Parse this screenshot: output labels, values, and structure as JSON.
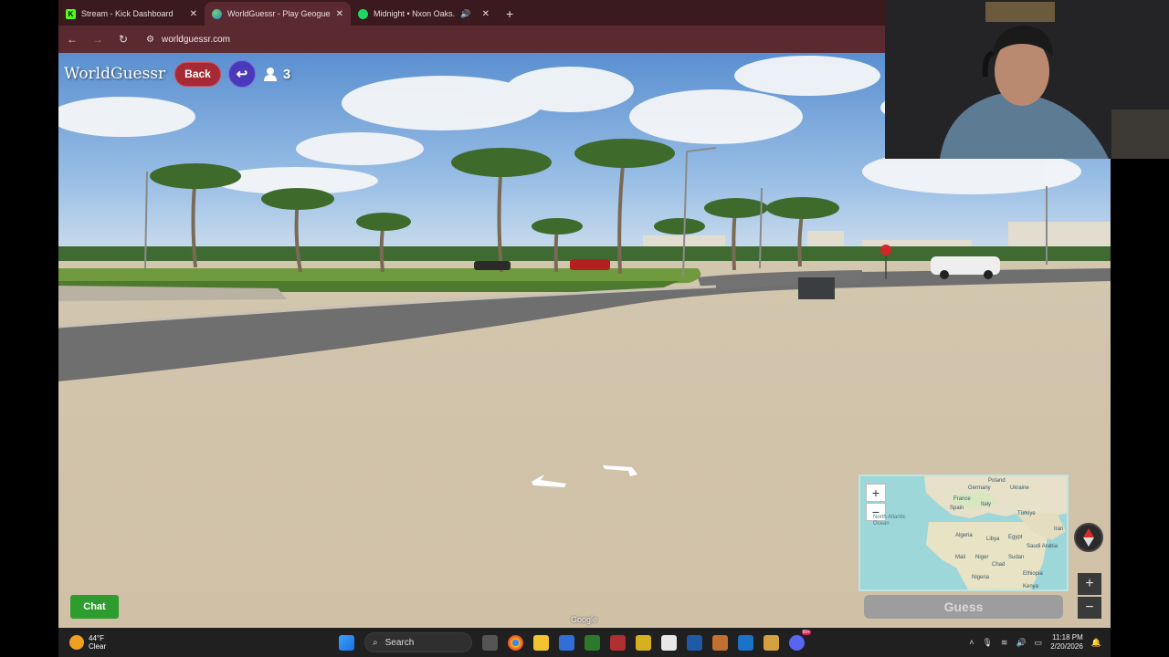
{
  "browser": {
    "tabs": [
      {
        "title": "Stream - Kick Dashboard",
        "favicon": "K",
        "color": "#53fc18",
        "active": false
      },
      {
        "title": "WorldGuessr - Play Geoguessr",
        "favicon": "globe",
        "color": "#3b8bd9",
        "active": true
      },
      {
        "title": "Midnight • Nxon Oaks.",
        "favicon": "spotify",
        "color": "#1ed760",
        "active": false
      }
    ],
    "address": "worldguessr.com"
  },
  "game": {
    "brand": "WorldGuessr",
    "back_label": "Back",
    "players_count": "3",
    "chat_label": "Chat",
    "guess_label": "Guess",
    "google_mark": "Google",
    "map_labels": [
      "Poland",
      "Germany",
      "Ukraine",
      "France",
      "Spain",
      "Italy",
      "Türkiye",
      "Iran",
      "North Atlantic Ocean",
      "Libya",
      "Egypt",
      "Algeria",
      "Mali",
      "Niger",
      "Chad",
      "Sudan",
      "Saudi Arabia",
      "Ethiopia",
      "Kenya",
      "Nigeria"
    ]
  },
  "taskbar": {
    "temp": "44°F",
    "condition": "Clear",
    "search_label": "Search",
    "time": "11:18 PM",
    "date": "2/20/2026",
    "badge": "99+"
  }
}
